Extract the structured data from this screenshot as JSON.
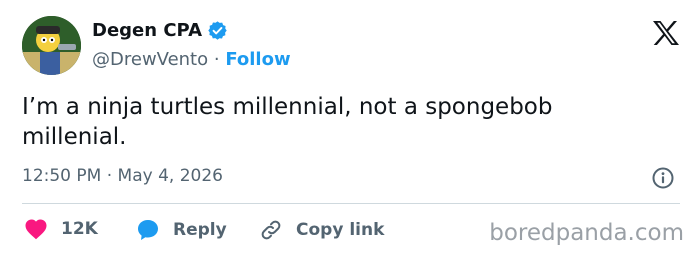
{
  "author": {
    "display_name": "Degen CPA",
    "handle": "@DrewVento",
    "separator": "·",
    "follow_label": "Follow",
    "verified_icon": "verified-badge-icon",
    "avatar": "cartoon-character-avatar"
  },
  "tweet": {
    "text": "I’m a ninja turtles millennial, not a spongebob millenial.",
    "time": "12:50 PM",
    "separator": "·",
    "date": "May 4, 2026"
  },
  "actions": {
    "like_count": "12K",
    "reply_label": "Reply",
    "copy_label": "Copy link"
  },
  "watermark": "boredpanda.com",
  "colors": {
    "accent": "#1d9bf0",
    "like": "#f91880",
    "secondary_text": "#536471",
    "divider": "#cfd9de"
  }
}
